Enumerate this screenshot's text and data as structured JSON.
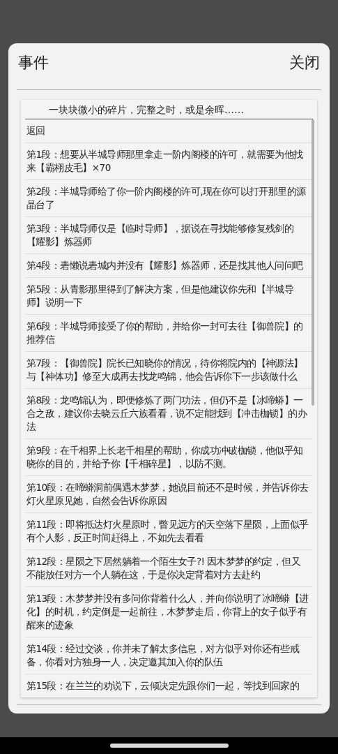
{
  "dialog": {
    "title": "事件",
    "close_label": "关闭"
  },
  "event_log": {
    "subtitle": "一块块微小的碎片，完整之时，或是余晖……",
    "back_label": "返回",
    "entries": [
      {
        "text": "第1段：想要从半城导师那里拿走一阶内阁楼的许可，就需要为他找来【霸栩皮毛】×70"
      },
      {
        "text": "第2段：半城导师给了你一阶内阁楼的许可,现在你可以打开那里的源晶台了"
      },
      {
        "text": "第3段：半城导师仅是【临时导师】，据说在寻找能够修复残剑的【耀影】炼器师"
      },
      {
        "text": "第4段：砉懒说砉城内并没有【耀影】炼器师，还是找其他人问问吧"
      },
      {
        "text": "第5段：从青影那里得到了解决方案，但是他建议你先和【半城导师】说明一下"
      },
      {
        "text": "第6段：半城导师接受了你的帮助，并给你一封可去往【御兽院】的推荐信"
      },
      {
        "text": "第7段：【御兽院】院长已知晓你的情况，待你将院内的【神源法】与【神体功】修至大成再去找龙鸣锦，他会告诉你下一步该做什么"
      },
      {
        "text": "第8段：龙鸣锦认为，即便修炼了两门功法，但仍不是【冰啼蟒】一合之敌，建议你去晓云丘六族看看，说不定能找到【冲击枷锁】的办法"
      },
      {
        "text": "第9段：在千相界上长老千相星的帮助，你成功冲破枷锁，他似乎知晓你的目的，并给予你【千相碎星】，以防不测。"
      },
      {
        "text": "第10段：在啼蟒洞前偶遇木梦梦，她说目前还不是时候，并告诉你去灯火星原见她，自然会告诉你原因"
      },
      {
        "text": "第11段：即将抵达灯火星原时，瞥见远方的天空落下星陨，上面似乎有个人影，反正时间赶得上，不如先去看看"
      },
      {
        "text": "第12段：星陨之下居然躺着一个陌生女子?! 因木梦梦的约定，但又不能放任对方一个人躺在这，于是你决定背着对方去赴约"
      },
      {
        "text": "第13段：木梦梦并没有多问你背着什么人，并向你说明了冰啼蟒【进化】的时机，约定倒是一起前往，木梦梦走后，你背上的女子似乎有醒来的迹象"
      },
      {
        "text": "第14段：经过交谈，你并未了解太多信息，对方似乎对你还有些戒备，你看对方独身一人，决定邀其加入你的队伍"
      },
      {
        "text": "第15段：在兰兰的劝说下，云倾决定先跟你们一起，等找到回家的"
      }
    ]
  }
}
